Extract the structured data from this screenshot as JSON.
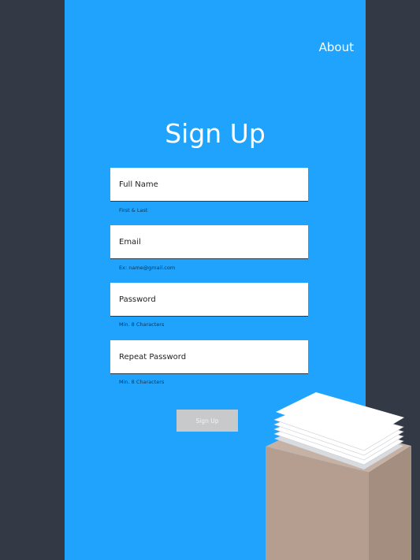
{
  "nav": {
    "about_label": "About"
  },
  "form": {
    "title": "Sign Up",
    "fields": [
      {
        "placeholder": "Full Name",
        "hint": "First & Last"
      },
      {
        "placeholder": "Email",
        "hint": "Ex: name@gmail.com"
      },
      {
        "placeholder": "Password",
        "hint": "Min. 8 Characters"
      },
      {
        "placeholder": "Repeat Password",
        "hint": "Min. 8 Characters"
      }
    ],
    "submit_label": "Sign Up"
  },
  "colors": {
    "background": "#343a45",
    "panel": "#1fa3fc",
    "button": "#c7c9cb",
    "box_front": "#b59e8f",
    "box_side": "#a48e80",
    "box_top": "#c6b2a5"
  }
}
